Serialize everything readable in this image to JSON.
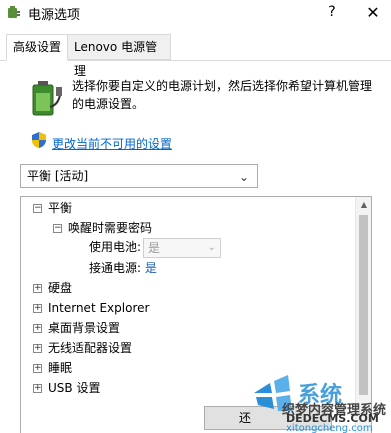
{
  "window": {
    "title": "电源选项",
    "help_label": "?",
    "close_label": "✕"
  },
  "tabs": [
    {
      "label": "高级设置",
      "active": true
    },
    {
      "label": "Lenovo 电源管理",
      "active": false
    }
  ],
  "description": "选择你要自定义的电源计划，然后选择你希望计算机管理的电源设置。",
  "change_link": "更改当前不可用的设置",
  "plan_select": {
    "value": "平衡 [活动]"
  },
  "tree": [
    {
      "label": "平衡",
      "toggle": "−",
      "children": [
        {
          "label": "唤醒时需要密码",
          "toggle": "−",
          "settings": [
            {
              "label": "使用电池:",
              "value": "是",
              "disabled": true
            },
            {
              "label": "接通电源:",
              "value": "是"
            }
          ]
        }
      ]
    },
    {
      "label": "硬盘",
      "toggle": "+"
    },
    {
      "label": "Internet Explorer",
      "toggle": "+"
    },
    {
      "label": "桌面背景设置",
      "toggle": "+"
    },
    {
      "label": "无线适配器设置",
      "toggle": "+"
    },
    {
      "label": "睡眠",
      "toggle": "+"
    },
    {
      "label": "USB 设置",
      "toggle": "+"
    }
  ],
  "restore_button": "还",
  "watermark": {
    "big": "系统",
    "line1": "织梦内容管理系统",
    "line2": "DEDECMS.COM",
    "line3": "xitongcheng.com"
  },
  "icons": {
    "app": "power-options-icon",
    "battery": "battery-plug-icon",
    "shield": "uac-shield-icon"
  }
}
